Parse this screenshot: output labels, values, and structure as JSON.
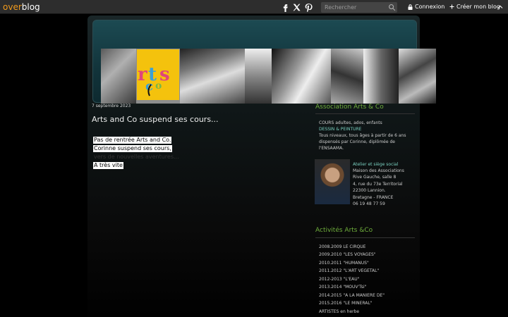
{
  "topbar": {
    "logo_over": "over",
    "logo_blog": "blog",
    "search_placeholder": "Rechercher",
    "login": "Connexion",
    "create": "Créer mon blog",
    "icons": [
      "facebook-icon",
      "x-icon",
      "pinterest-icon",
      "search-icon",
      "lock-icon",
      "plus-icon",
      "chevron-up-icon"
    ]
  },
  "post": {
    "date": "7 septembre 2023",
    "title": "Arts and Co suspend ses cours...",
    "lines": [
      "Pas de rentrée Arts and Co.",
      "Corinne suspend ses cours,",
      "vers de nouvelles aventures...",
      "A très vite"
    ]
  },
  "sidebar": {
    "assoc_title": "Association Arts & Co",
    "cours": "COURS adultes, ados, enfants",
    "dessin": "DESSIN & PEINTURE",
    "desc": [
      "Tous niveaux, tous âges à partir de 6 ans",
      "dispensés par Corinne, diplômée de",
      "l'ENSAAMA."
    ],
    "atelier_title": "Atelier et siège social",
    "address": [
      "Maison des Associations",
      "Rive Gauche, salle 8",
      "4, rue du 73e Territorial",
      "22300 Lannion.",
      "Bretagne - FRANCE",
      "06 19 48 77 59"
    ],
    "activites_title": "Activités Arts &Co",
    "activites": [
      "2008.2009 LE CIRQUE",
      "2009.2010 \"LES VOYAGES\"",
      "2010.2011 \"HUMANUS\"",
      "2011.2012 \"L'ART VEGETAL\"",
      "2012-2013 \"L'EAU\"",
      "2013.2014 \"MOUV'Tsi\"",
      "2014.2015 \"A LA MANIERE DE\"",
      "2015.2016 \"LE MINERAL\"",
      "ARTISTES en herbe"
    ]
  },
  "colors": {
    "brand_orange": "#f29b1d",
    "sidebar_title": "#6fae3c",
    "accent_teal": "#7ad0c0",
    "logo_yellow": "#f4c20d"
  }
}
